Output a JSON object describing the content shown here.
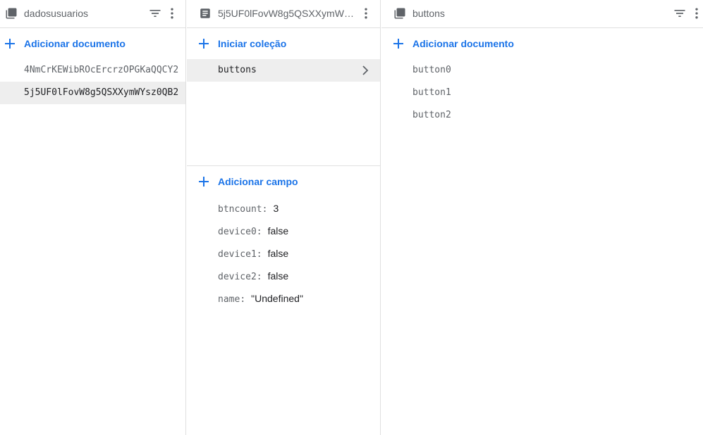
{
  "panel1": {
    "title": "dadosusuarios",
    "icons": [
      "collection-icon",
      "filter-icon",
      "more-vert-icon"
    ],
    "add_label": "Adicionar documento",
    "documents": [
      {
        "id": "4NmCrKEWibROcErcrzOPGKaQQCY2",
        "selected": false
      },
      {
        "id": "5j5UF0lFovW8g5QSXXymWYsz0QB2",
        "selected": true
      }
    ]
  },
  "panel2": {
    "title": "5j5UF0lFovW8g5QSXXymWYs...",
    "icons": [
      "document-icon",
      "more-vert-icon"
    ],
    "start_collection_label": "Iniciar coleção",
    "collections": [
      {
        "name": "buttons",
        "selected": true
      }
    ],
    "add_field_label": "Adicionar campo",
    "fields": [
      {
        "key": "btncount",
        "value": "3"
      },
      {
        "key": "device0",
        "value": "false"
      },
      {
        "key": "device1",
        "value": "false"
      },
      {
        "key": "device2",
        "value": "false"
      },
      {
        "key": "name",
        "value": "\"Undefined\""
      }
    ]
  },
  "panel3": {
    "title": "buttons",
    "icons": [
      "collection-icon",
      "filter-icon",
      "more-vert-icon"
    ],
    "add_label": "Adicionar documento",
    "documents": [
      "button0",
      "button1",
      "button2"
    ]
  },
  "colors": {
    "accent": "#1a73e8",
    "selected_bg": "#eeeeee",
    "border": "#e0e0e0",
    "muted_text": "#5f6368"
  }
}
